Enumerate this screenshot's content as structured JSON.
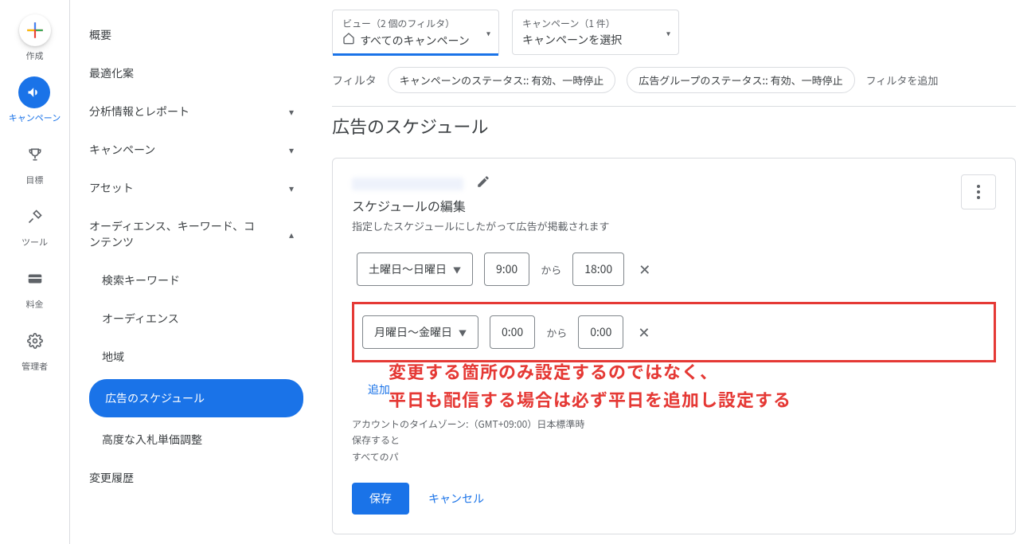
{
  "rail": {
    "create": "作成",
    "campaign": "キャンペーン",
    "goal": "目標",
    "tool": "ツール",
    "fee": "料金",
    "admin": "管理者"
  },
  "sidebar": {
    "overview": "概要",
    "optimization": "最適化案",
    "reports": "分析情報とレポート",
    "campaign": "キャンペーン",
    "asset": "アセット",
    "audience_kw": "オーディエンス、キーワード、コンテンツ",
    "search_kw": "検索キーワード",
    "audience": "オーディエンス",
    "region": "地域",
    "ad_schedule": "広告のスケジュール",
    "bid_adj": "高度な入札単価調整",
    "history": "変更履歴"
  },
  "top": {
    "view_label": "ビュー（2 個のフィルタ）",
    "view_value": "すべてのキャンペーン",
    "campaign_label": "キャンペーン（1 件）",
    "campaign_value": "キャンペーンを選択"
  },
  "filter": {
    "label": "フィルタ",
    "chip1": "キャンペーンのステータス:: 有効、一時停止",
    "chip2": "広告グループのステータス:: 有効、一時停止",
    "add": "フィルタを追加"
  },
  "page_title": "広告のスケジュール",
  "card": {
    "subtitle": "スケジュールの編集",
    "subdesc": "指定したスケジュールにしたがって広告が掲載されます",
    "rows": [
      {
        "days": "土曜日～日曜日",
        "start": "9:00",
        "end": "18:00"
      },
      {
        "days": "月曜日～金曜日",
        "start": "0:00",
        "end": "0:00"
      }
    ],
    "between": "から",
    "add": "追加",
    "tz_line1": "アカウントのタイムゾーン:（GMT+09:00）日本標準時",
    "tz_line2": "保存すると",
    "tz_line3": "すべてのパ",
    "save": "保存",
    "cancel": "キャンセル"
  },
  "annotation": {
    "line1": "変更する箇所のみ設定するのではなく、",
    "line2": "平日も配信する場合は必ず平日を追加し設定する"
  }
}
